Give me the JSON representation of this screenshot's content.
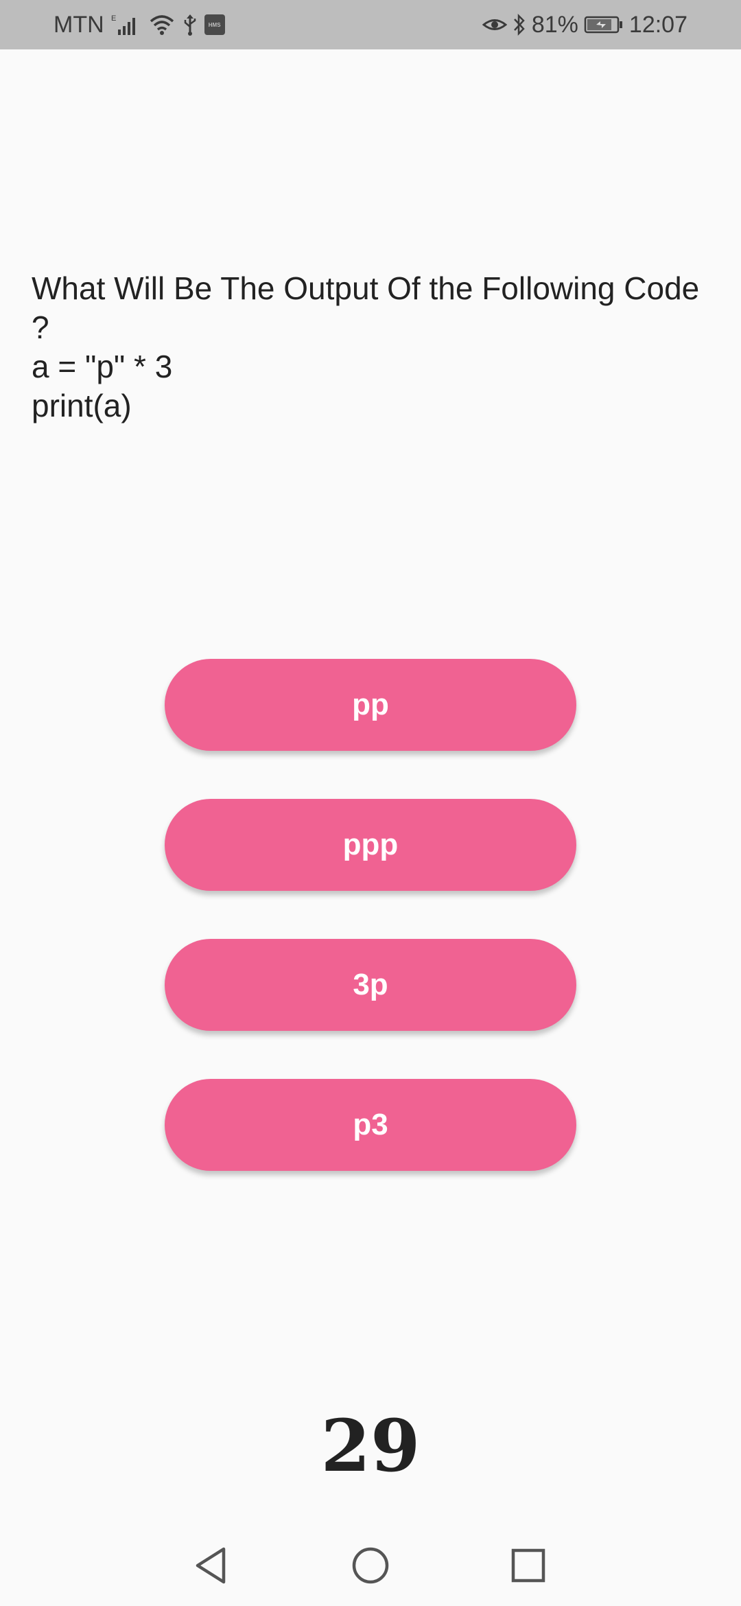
{
  "status_bar": {
    "carrier": "MTN",
    "network_type": "E",
    "hms_label": "HMS",
    "battery_percent": "81%",
    "time": "12:07"
  },
  "question": {
    "text": "What Will Be The Output Of the Following Code ?\na = \"p\" * 3\nprint(a)"
  },
  "answers": [
    {
      "label": "pp"
    },
    {
      "label": "ppp"
    },
    {
      "label": "3p"
    },
    {
      "label": "p3"
    }
  ],
  "counter": "29",
  "colors": {
    "button": "#f06292",
    "button_text": "#ffffff",
    "status_bar": "#bdbdbd",
    "background": "#fafafa"
  },
  "nav_icons": [
    "back-icon",
    "home-icon",
    "recents-icon"
  ]
}
